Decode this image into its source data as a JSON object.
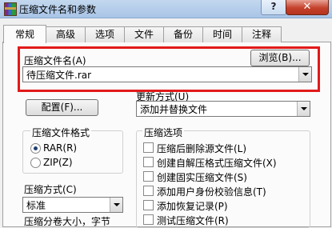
{
  "window": {
    "title": "压缩文件名和参数",
    "help_label": "?",
    "close_label": "✕",
    "app_icon": "winrar-books-icon"
  },
  "tabs": [
    {
      "label": "常规"
    },
    {
      "label": "高级"
    },
    {
      "label": "选项"
    },
    {
      "label": "文件"
    },
    {
      "label": "备份"
    },
    {
      "label": "时间"
    },
    {
      "label": "注释"
    }
  ],
  "archive_name": {
    "label": "压缩文件名(A)",
    "browse_label": "浏览(B)...",
    "value": "待压缩文件.rar"
  },
  "profiles_label": "配置(F)...",
  "update_mode": {
    "label": "更新方式(U)",
    "value": "添加并替换文件"
  },
  "archive_format": {
    "label": "压缩文件格式",
    "options": [
      {
        "label": "RAR(R)",
        "checked": true
      },
      {
        "label": "ZIP(Z)",
        "checked": false
      }
    ]
  },
  "compression_method": {
    "label": "压缩方式(C)",
    "value": "标准"
  },
  "split_label": "压缩分卷大小，字节",
  "archive_options": {
    "label": "压缩选项",
    "items": [
      {
        "label": "压缩后删除源文件(L)",
        "checked": false
      },
      {
        "label": "创建自解压格式压缩文件(X)",
        "checked": false
      },
      {
        "label": "创建固实压缩文件(S)",
        "checked": false
      },
      {
        "label": "添加用户身份校验信息(T)",
        "checked": false
      },
      {
        "label": "添加恢复记录(P)",
        "checked": false
      },
      {
        "label": "测试压缩文件(R)",
        "checked": false
      }
    ]
  },
  "colors": {
    "highlight_frame": "#e21a1a",
    "titlebar": "#b7cfeb",
    "close_button": "#c4412b"
  }
}
